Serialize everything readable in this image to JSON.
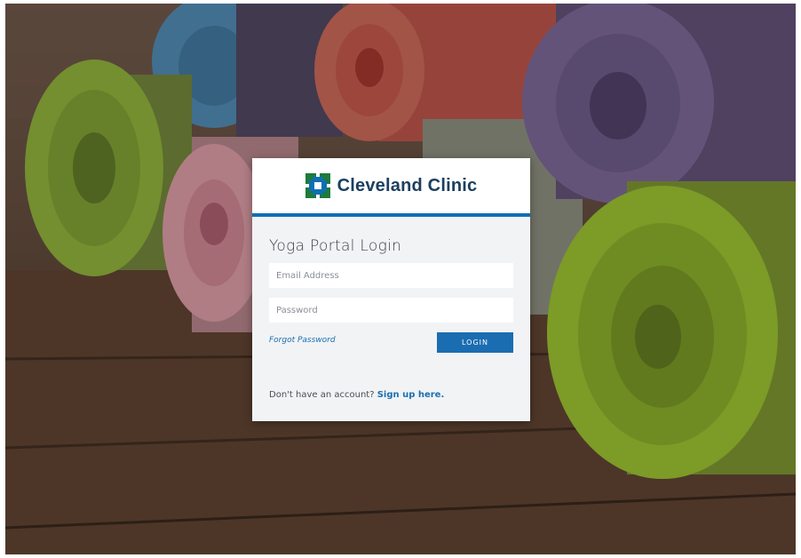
{
  "brand": {
    "name": "Cleveland Clinic",
    "logo_icon": "cleveland-clinic-logo-icon",
    "color": "#1c3f60",
    "accent": "#0e6fb5"
  },
  "login": {
    "title": "Yoga Portal Login",
    "email_placeholder": "Email Address",
    "password_placeholder": "Password",
    "forgot_label": "Forgot Password",
    "button_label": "LOGIN",
    "signup_prompt": "Don't have an account?",
    "signup_link": "Sign up here."
  },
  "background": {
    "description_icon": "yoga-mats-photo"
  }
}
